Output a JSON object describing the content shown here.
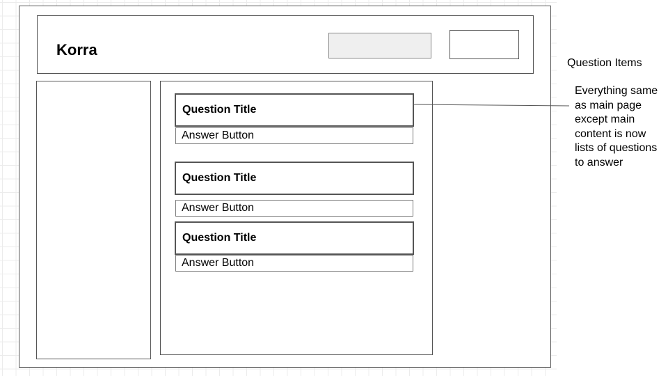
{
  "header": {
    "logo": "Korra"
  },
  "questions": [
    {
      "title": "Question Title",
      "answer_label": "Answer Button"
    },
    {
      "title": "Question Title",
      "answer_label": "Answer Button"
    },
    {
      "title": "Question Title",
      "answer_label": "Answer Button"
    }
  ],
  "annotation": {
    "title": "Question Items",
    "body": "Everything same as main page except main content is now lists of questions to answer"
  }
}
